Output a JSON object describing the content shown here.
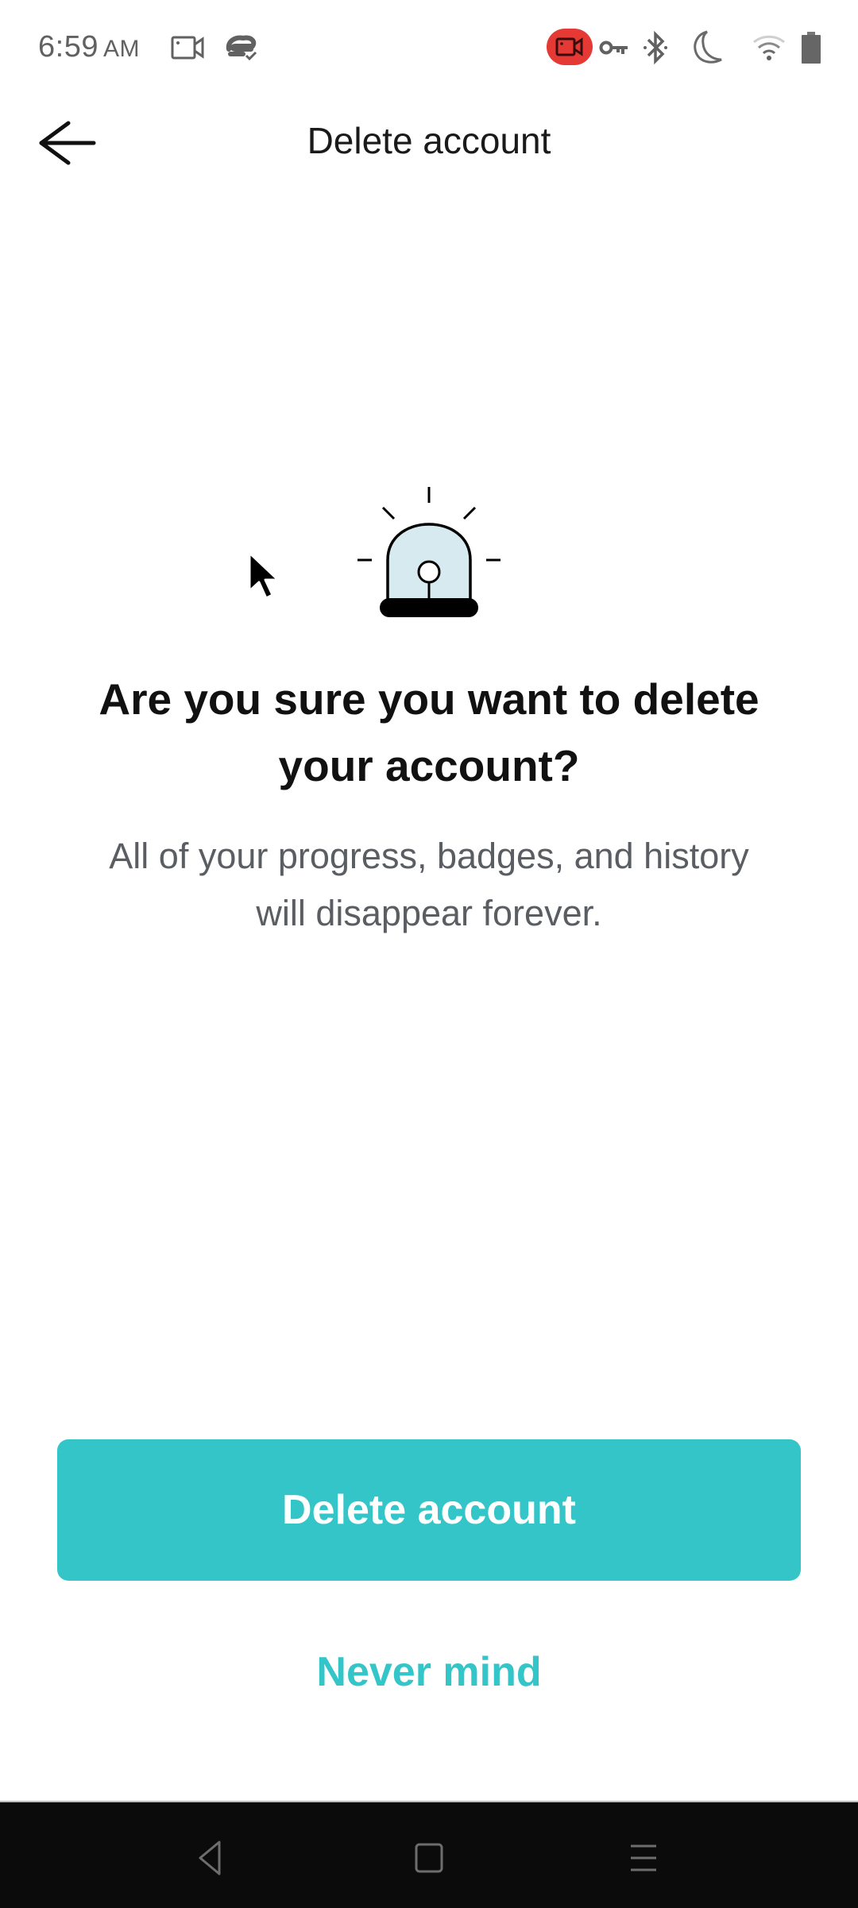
{
  "status_bar": {
    "time": "6:59",
    "ampm": "AM",
    "left_icons": [
      "screen-record-icon",
      "cloud-sync-icon"
    ],
    "right_icons": [
      "recording-active-icon",
      "vpn-key-icon",
      "bluetooth-icon",
      "do-not-disturb-moon-icon",
      "wifi-icon",
      "battery-icon"
    ],
    "recording_badge_color": "#e53935"
  },
  "toolbar": {
    "back_icon": "arrow-left-icon",
    "title": "Delete account"
  },
  "content": {
    "illustration": "siren-alarm-icon",
    "headline_line1": "Are you sure you want to delete",
    "headline_line2": "your account?",
    "body_line1": "All of your progress, badges, and history",
    "body_line2": "will disappear forever."
  },
  "actions": {
    "primary_label": "Delete account",
    "secondary_label": "Never mind",
    "accent_color": "#33c5c8"
  },
  "nav_bar": {
    "buttons": [
      "back-triangle-icon",
      "home-square-icon",
      "menu-lines-icon"
    ]
  }
}
